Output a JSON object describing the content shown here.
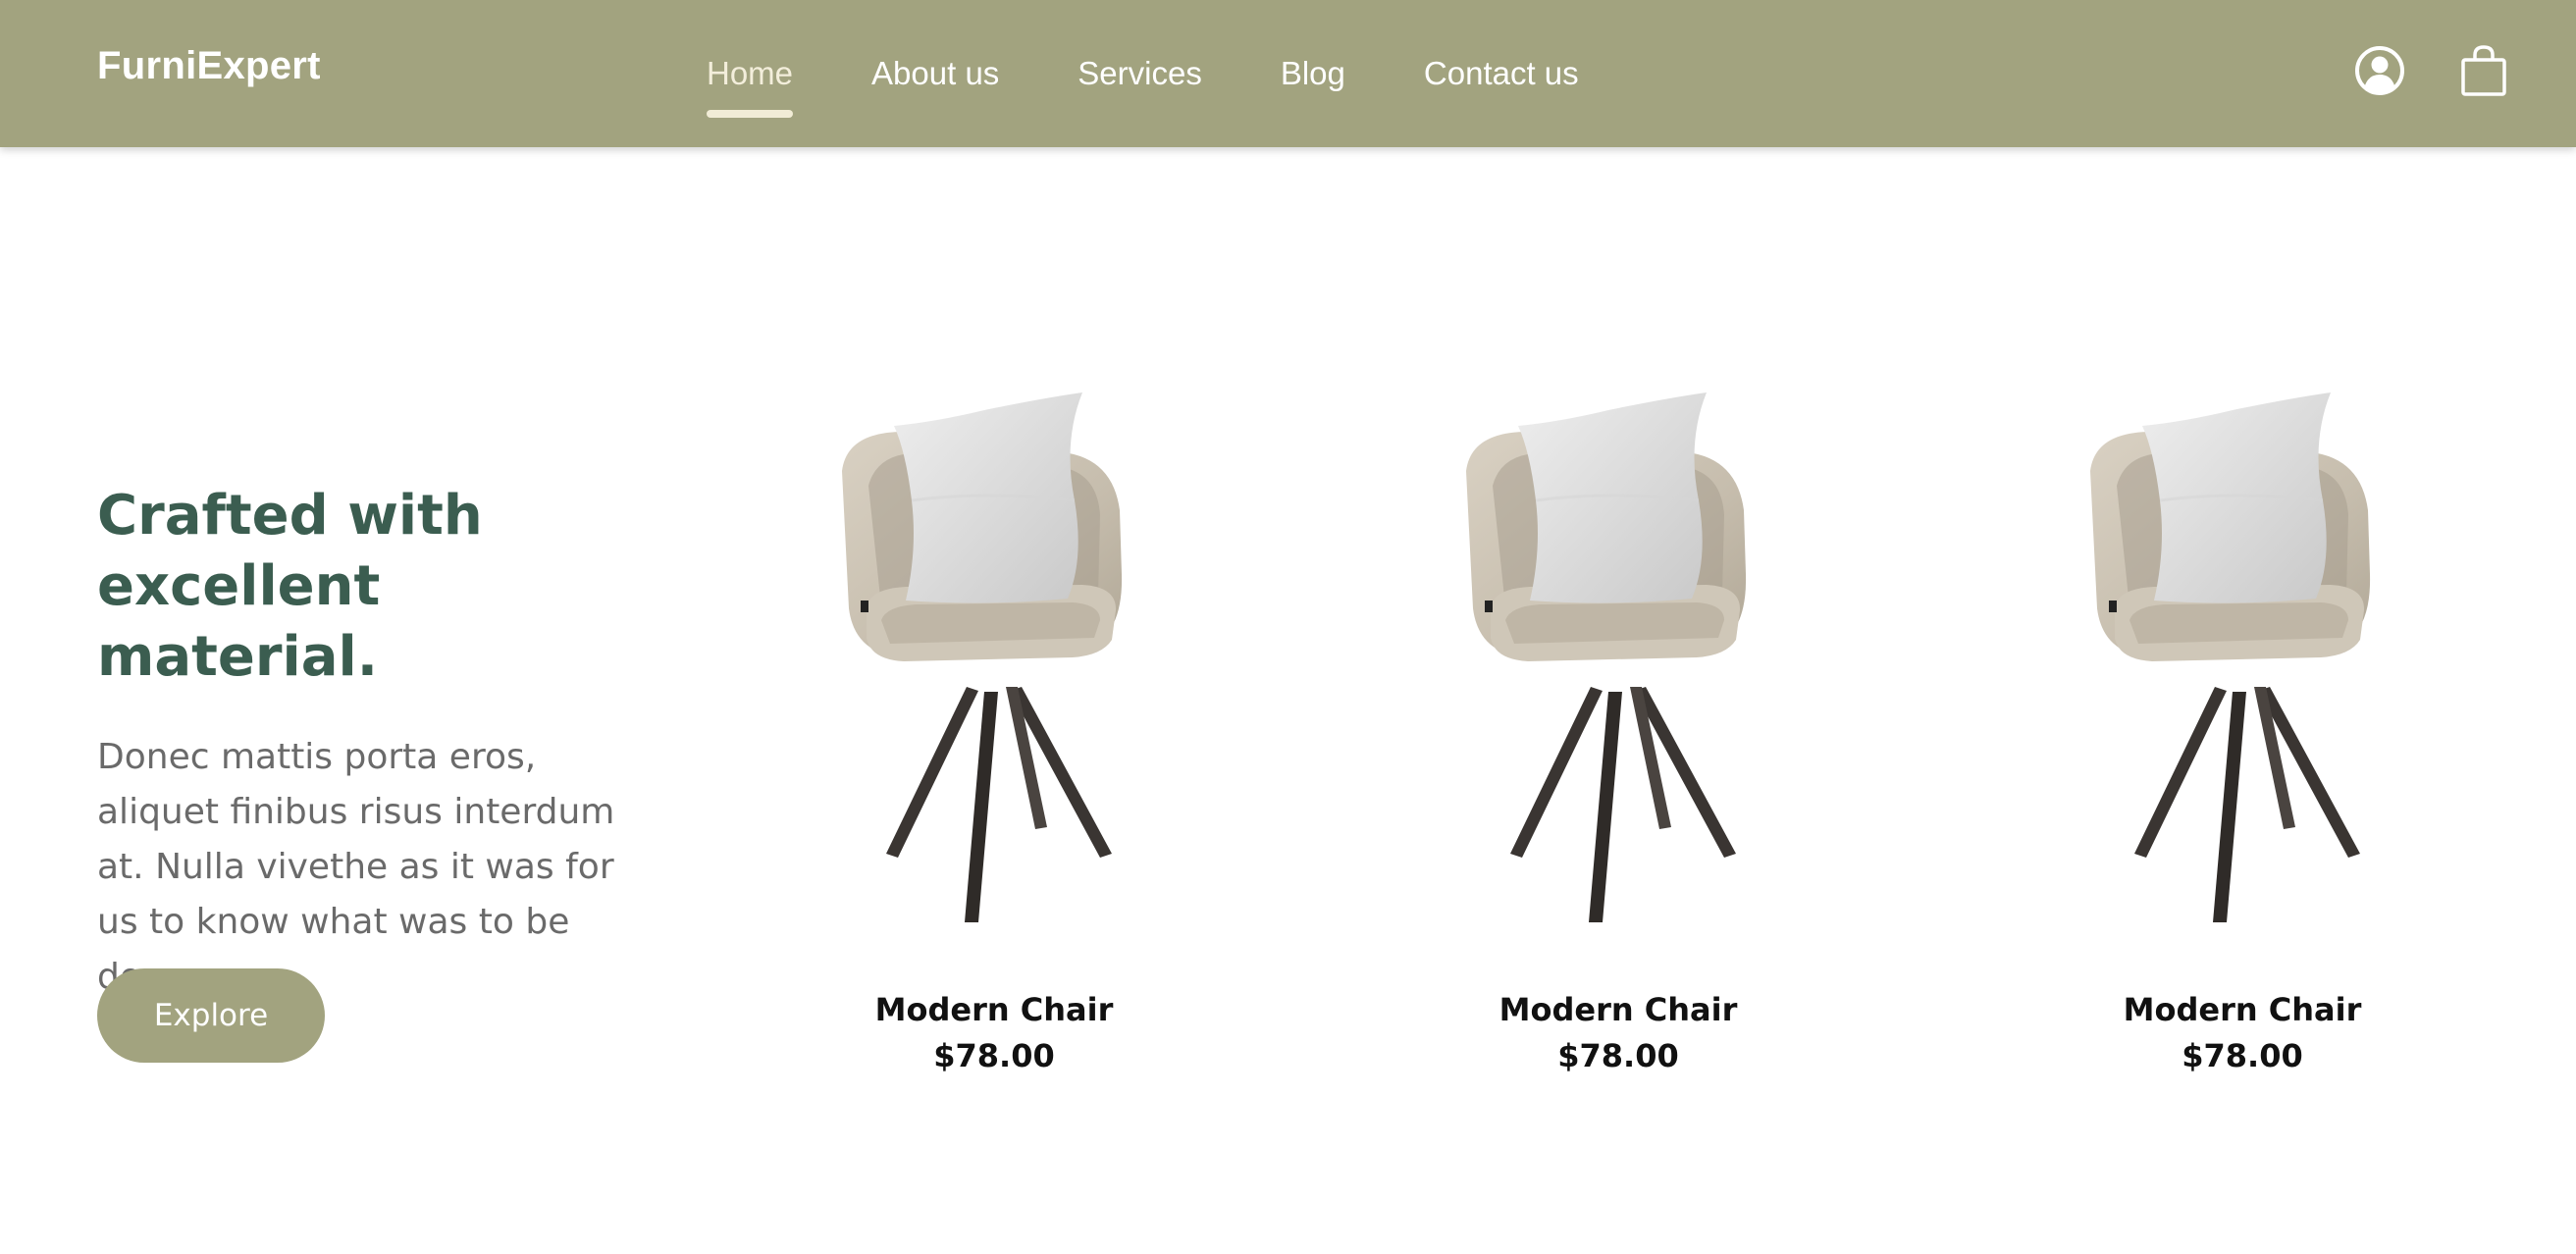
{
  "brand": {
    "name": "FurniExpert"
  },
  "nav": {
    "items": [
      {
        "label": "Home",
        "active": true
      },
      {
        "label": "About us"
      },
      {
        "label": "Services"
      },
      {
        "label": "Blog"
      },
      {
        "label": "Contact us"
      }
    ],
    "icons": [
      "user-icon",
      "shopping-bag-icon"
    ]
  },
  "hero": {
    "title": "Crafted with excellent material.",
    "description": "Donec mattis porta eros, aliquet finibus risus interdum at. Nulla vivethe as it was for us to know what was to be done.",
    "button_label": "Explore"
  },
  "products": [
    {
      "name": "Modern Chair",
      "price": "$78.00"
    },
    {
      "name": "Modern Chair",
      "price": "$78.00"
    },
    {
      "name": "Modern Chair",
      "price": "$78.00"
    }
  ],
  "colors": {
    "nav_bg": "#a2a37f",
    "title": "#3b5d50",
    "text_muted": "#6a6a6a",
    "button_bg": "#a2a37f"
  }
}
